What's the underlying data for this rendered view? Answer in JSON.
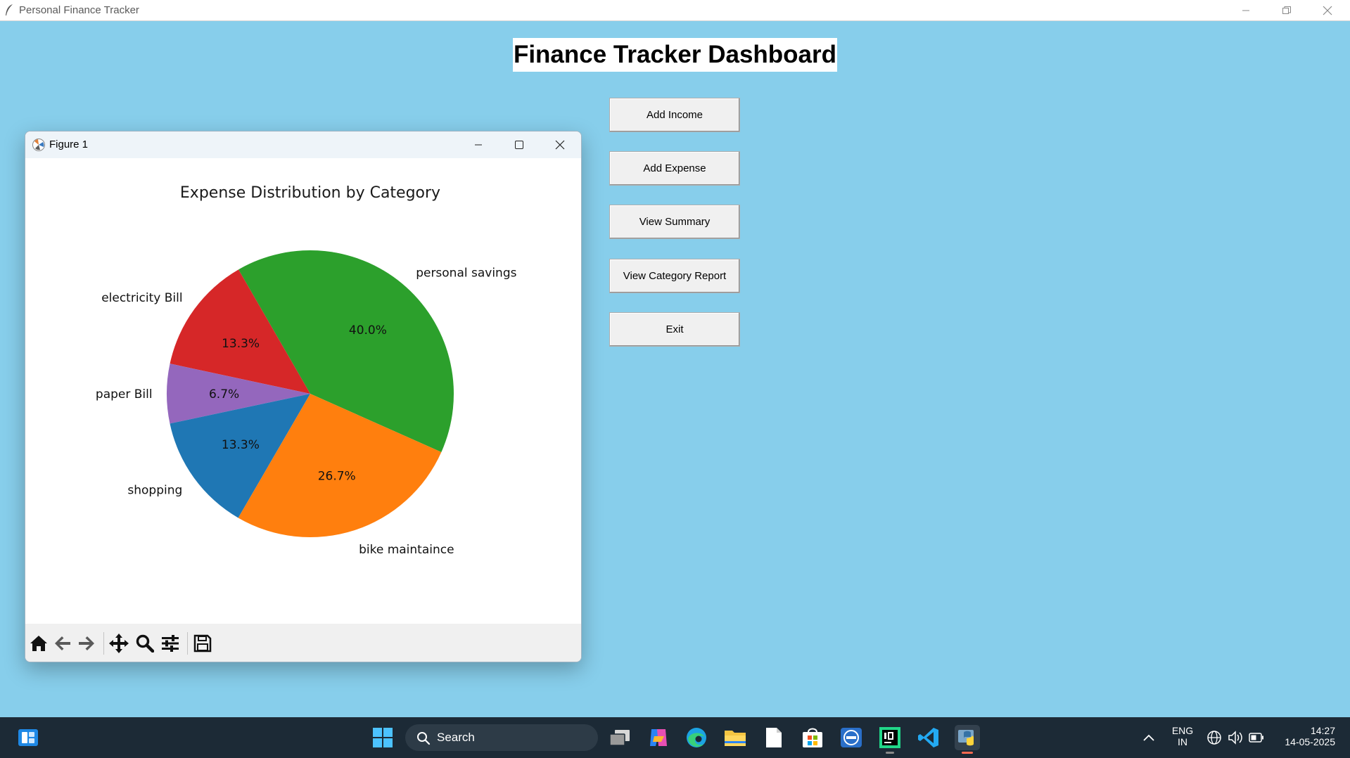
{
  "app": {
    "window_title": "Personal Finance Tracker",
    "dashboard_title": "Finance Tracker Dashboard",
    "background_color": "#87CEEB",
    "buttons": [
      {
        "label": "Add Income"
      },
      {
        "label": "Add Expense"
      },
      {
        "label": "View Summary"
      },
      {
        "label": "View Category Report"
      },
      {
        "label": "Exit"
      }
    ]
  },
  "figure_window": {
    "title": "Figure 1",
    "toolbar": [
      "home-icon",
      "back-arrow-icon",
      "forward-arrow-icon",
      "pan-icon",
      "zoom-icon",
      "configure-subplots-icon",
      "save-icon"
    ]
  },
  "chart_data": {
    "type": "pie",
    "title": "Expense Distribution by Category",
    "slices": [
      {
        "label": "personal savings",
        "percent": 40.0,
        "pct_label": "40.0%",
        "color": "#2ca02c"
      },
      {
        "label": "electricity Bill",
        "percent": 13.3,
        "pct_label": "13.3%",
        "color": "#d62728"
      },
      {
        "label": "paper Bill",
        "percent": 6.7,
        "pct_label": "6.7%",
        "color": "#9467bd"
      },
      {
        "label": "shopping",
        "percent": 13.3,
        "pct_label": "13.3%",
        "color": "#1f77b4"
      },
      {
        "label": "bike maintaince",
        "percent": 26.7,
        "pct_label": "26.7%",
        "color": "#ff7f0e"
      }
    ]
  },
  "taskbar": {
    "search_label": "Search",
    "language_top": "ENG",
    "language_bottom": "IN",
    "time": "14:27",
    "date": "14-05-2025",
    "apps": [
      "widgets-icon",
      "start-icon",
      "task-view-icon",
      "copilot-icon",
      "edge-icon",
      "file-explorer-icon",
      "notepad-icon",
      "microsoft-store-icon",
      "dell-icon",
      "pycharm-icon",
      "vscode-icon",
      "python-app-icon"
    ]
  }
}
